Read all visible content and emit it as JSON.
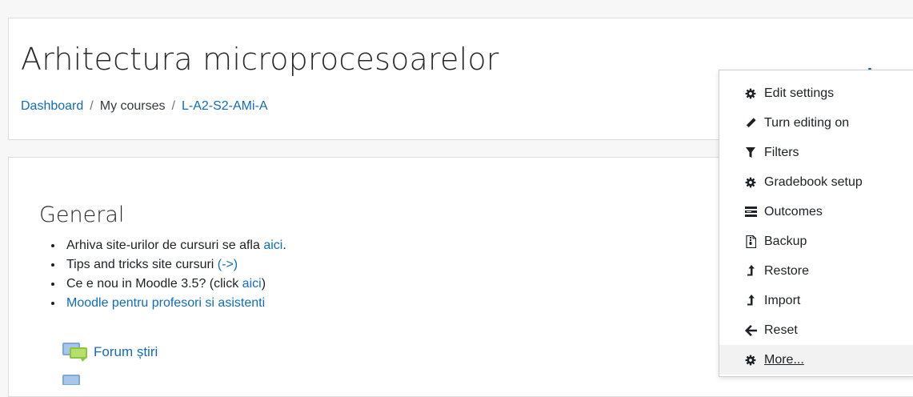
{
  "header": {
    "course_title": "Arhitectura microprocesoarelor",
    "breadcrumb": {
      "dashboard": "Dashboard",
      "sep1": "/",
      "my_courses": "My courses",
      "sep2": "/",
      "course_code": "L-A2-S2-AMi-A"
    },
    "gear_icon": "gear-icon",
    "caret_icon": "caret-down-icon"
  },
  "section": {
    "title": "General",
    "items": [
      {
        "text": "Arhiva site-urilor de cursuri se afla ",
        "link": "aici",
        "suffix": "."
      },
      {
        "text": "Tips and tricks site cursuri ",
        "link": "(->)"
      },
      {
        "text": "Ce e nou in Moodle 3.5? (click ",
        "link": "aici",
        "suffix": ")"
      },
      {
        "link": "Moodle pentru profesori si asistenti"
      }
    ],
    "activity_label": "Forum știri"
  },
  "menu": {
    "items": [
      {
        "label": "Edit settings",
        "icon": "cog-icon"
      },
      {
        "label": "Turn editing on",
        "icon": "pencil-icon"
      },
      {
        "label": "Filters",
        "icon": "filter-icon"
      },
      {
        "label": "Gradebook setup",
        "icon": "cog-icon"
      },
      {
        "label": "Outcomes",
        "icon": "outcomes-icon"
      },
      {
        "label": "Backup",
        "icon": "file-archive-icon"
      },
      {
        "label": "Restore",
        "icon": "level-up-icon"
      },
      {
        "label": "Import",
        "icon": "level-up-icon"
      },
      {
        "label": "Reset",
        "icon": "arrow-left-icon"
      },
      {
        "label": "More...",
        "icon": "cog-icon"
      }
    ]
  },
  "colors": {
    "link": "#0f6cbf",
    "text": "#1d2125",
    "background": "#f7f7f7"
  }
}
